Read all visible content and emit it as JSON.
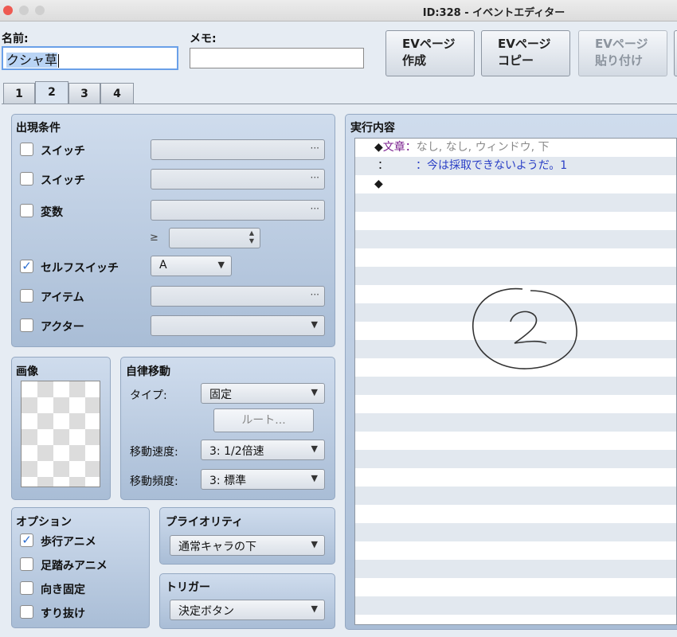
{
  "window": {
    "title": "ID:328 - イベントエディター"
  },
  "header": {
    "name_label": "名前:",
    "name_value": "クシャ草",
    "memo_label": "メモ:",
    "memo_value": ""
  },
  "page_buttons": [
    {
      "line1": "EVページ",
      "line2": "作成",
      "enabled": true
    },
    {
      "line1": "EVページ",
      "line2": "コピー",
      "enabled": true
    },
    {
      "line1": "EVページ",
      "line2": "貼り付け",
      "enabled": false
    }
  ],
  "tabs": [
    "1",
    "2",
    "3",
    "4"
  ],
  "active_tab": "2",
  "conditions": {
    "title": "出現条件",
    "switch1": {
      "label": "スイッチ",
      "checked": false
    },
    "switch2": {
      "label": "スイッチ",
      "checked": false
    },
    "variable": {
      "label": "変数",
      "checked": false
    },
    "geq": "≥",
    "self_switch": {
      "label": "セルフスイッチ",
      "checked": true,
      "value": "A"
    },
    "item": {
      "label": "アイテム",
      "checked": false
    },
    "actor": {
      "label": "アクター",
      "checked": false
    },
    "ellipsis": "···"
  },
  "image": {
    "title": "画像"
  },
  "autonomous": {
    "title": "自律移動",
    "type_label": "タイプ:",
    "type_value": "固定",
    "route_button": "ルート...",
    "speed_label": "移動速度:",
    "speed_value": "3: 1/2倍速",
    "freq_label": "移動頻度:",
    "freq_value": "3: 標準"
  },
  "options": {
    "title": "オプション",
    "walk_anime": {
      "label": "歩行アニメ",
      "checked": true
    },
    "step_anime": {
      "label": "足踏みアニメ",
      "checked": false
    },
    "dir_fix": {
      "label": "向き固定",
      "checked": false
    },
    "through": {
      "label": "すり抜け",
      "checked": false
    }
  },
  "priority": {
    "title": "プライオリティ",
    "value": "通常キャラの下"
  },
  "trigger": {
    "title": "トリガー",
    "value": "決定ボタン"
  },
  "contents": {
    "title": "実行内容",
    "commands": [
      {
        "bullet": "◆",
        "name": "文章",
        "sep": "：",
        "text": "なし, なし, ウィンドウ, 下"
      },
      {
        "bullet": "：",
        "name": "",
        "sep": "：",
        "text": "今は採取できないようだ。1"
      },
      {
        "bullet": "◆",
        "name": "",
        "sep": "",
        "text": ""
      }
    ]
  },
  "colors": {
    "command_name": "#7a1f8e",
    "command_text_gray": "#8a8a8a",
    "message_text": "#2a3fc6",
    "panel": "#b9cbe2",
    "accent_check": "#2f6fd0"
  }
}
